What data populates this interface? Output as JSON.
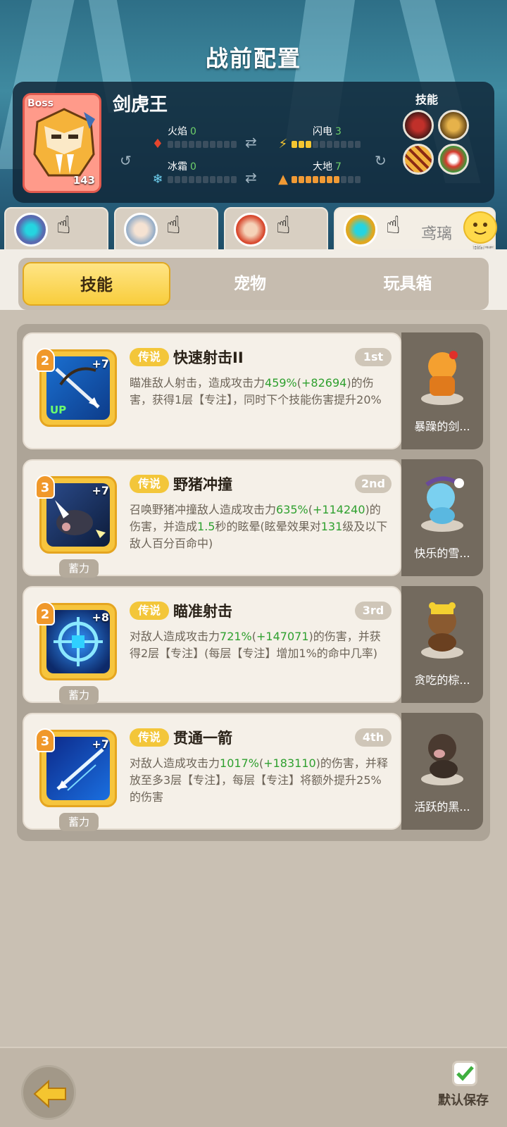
{
  "title": "战前配置",
  "boss": {
    "tag": "Boss",
    "name": "剑虎王",
    "level": "143",
    "elements": [
      {
        "label": "火焰",
        "value": "0",
        "level": 0
      },
      {
        "label": "闪电",
        "value": "3",
        "level": 3
      },
      {
        "label": "冰霜",
        "value": "0",
        "level": 0
      },
      {
        "label": "大地",
        "value": "7",
        "level": 7
      }
    ],
    "skills_label": "技能",
    "skill_icons": [
      "roar-icon",
      "beast-claw-icon",
      "slash-icon",
      "leaf-fist-icon"
    ]
  },
  "heroes": [
    {
      "portrait": "robot-hero-portrait"
    },
    {
      "portrait": "silver-hair-hero-portrait"
    },
    {
      "portrait": "red-hair-hero-portrait"
    },
    {
      "portrait": "robot-hero-gold-portrait",
      "name": "鸢璃",
      "active": true
    }
  ],
  "chat": {
    "label": "聊天"
  },
  "categories": [
    {
      "label": "技能",
      "active": true
    },
    {
      "label": "宠物",
      "active": false
    },
    {
      "label": "玩具箱",
      "active": false
    }
  ],
  "skills": [
    {
      "rank": "2",
      "plus": "+7",
      "up": "UP",
      "charge": "",
      "quality": "传说",
      "name": "快速射击II",
      "order": "1st",
      "desc": [
        {
          "t": "瞄准敌人射击，造成攻击力"
        },
        {
          "t": "459%",
          "hl": true
        },
        {
          "t": "("
        },
        {
          "t": "+82694",
          "hl": true
        },
        {
          "t": ")的伤害，获得1层【专注】，同时下个技能伤害提升20%"
        }
      ],
      "pet": "暴躁的剑..."
    },
    {
      "rank": "3",
      "plus": "+7",
      "up": "",
      "charge": "蓄力",
      "quality": "传说",
      "name": "野猪冲撞",
      "order": "2nd",
      "desc": [
        {
          "t": "召唤野猪冲撞敌人造成攻击力"
        },
        {
          "t": "635%",
          "hl": true
        },
        {
          "t": "("
        },
        {
          "t": "+114240",
          "hl": true
        },
        {
          "t": ")的伤害，并造成"
        },
        {
          "t": "1.5",
          "hl": true
        },
        {
          "t": "秒的眩晕(眩晕效果对"
        },
        {
          "t": "131",
          "hl": true
        },
        {
          "t": "级及以下敌人百分百命中)"
        }
      ],
      "pet": "快乐的雪..."
    },
    {
      "rank": "2",
      "plus": "+8",
      "up": "",
      "charge": "蓄力",
      "quality": "传说",
      "name": "瞄准射击",
      "order": "3rd",
      "desc": [
        {
          "t": "对敌人造成攻击力"
        },
        {
          "t": "721%",
          "hl": true
        },
        {
          "t": "("
        },
        {
          "t": "+147071",
          "hl": true
        },
        {
          "t": ")的伤害，并获得2层【专注】(每层【专注】增加1%的命中几率)"
        }
      ],
      "pet": "贪吃的棕..."
    },
    {
      "rank": "3",
      "plus": "+7",
      "up": "",
      "charge": "蓄力",
      "quality": "传说",
      "name": "贯通一箭",
      "order": "4th",
      "desc": [
        {
          "t": "对敌人造成攻击力"
        },
        {
          "t": "1017%",
          "hl": true
        },
        {
          "t": "("
        },
        {
          "t": "+183110",
          "hl": true
        },
        {
          "t": ")的伤害，并释放至多3层【专注】，每层【专注】将额外提升25%的伤害"
        }
      ],
      "pet": "活跃的黑..."
    }
  ],
  "footer": {
    "save_label": "默认保存",
    "save_checked": true
  },
  "colors": {
    "accent": "#f8cd3c",
    "highlight": "#2fa02f",
    "legend": "#f3c63a"
  }
}
